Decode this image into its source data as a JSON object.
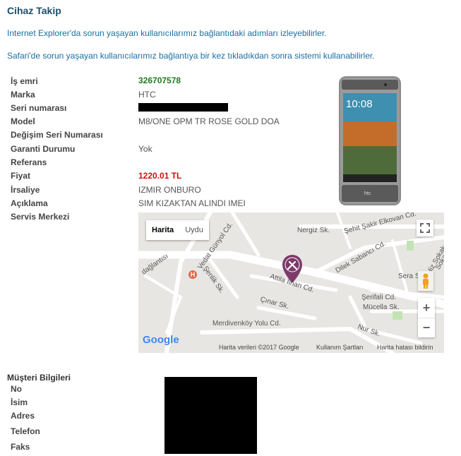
{
  "header": {
    "title": "Cihaz Takip"
  },
  "notes": {
    "ie": "Internet Explorer'da sorun yaşayan kullanıcılarımız bağlantıdaki adımları izleyebilirler.",
    "safari": "Safari'de sorun yaşayan kullanıcılarımız bağlantıya bir kez tıkladıkdan sonra sistemi kullanabilirler."
  },
  "details": {
    "is_emri": {
      "label": "İş emri",
      "value": "326707578"
    },
    "marka": {
      "label": "Marka",
      "value": "HTC"
    },
    "seri_no": {
      "label": "Seri numarası",
      "value": ""
    },
    "model": {
      "label": "Model",
      "value": "M8/ONE OPM TR ROSE GOLD DOA"
    },
    "degisim": {
      "label": "Değişim Seri Numarası",
      "value": ""
    },
    "garanti": {
      "label": "Garanti Durumu",
      "value": "Yok"
    },
    "referans": {
      "label": "Referans",
      "value": ""
    },
    "fiyat": {
      "label": "Fiyat",
      "value": "1220.01 TL"
    },
    "irsaliye": {
      "label": "İrsaliye",
      "value": "IZMIR ONBURO"
    },
    "aciklama": {
      "label": "Açıklama",
      "value": "SIM KIZAKTAN ALINDI IMEI"
    },
    "servis": {
      "label": "Servis Merkezi",
      "value": ""
    }
  },
  "phone": {
    "time": "10:08",
    "brand": "htc"
  },
  "map": {
    "type_map": "Harita",
    "type_sat": "Uydu",
    "streets": [
      "Nergiz Sk.",
      "Şehit Şakir Elkovan Cd.",
      "Vedat Günyol Cd.",
      "Dilek Sabancı Cd.",
      "Hiz Sokak",
      "Şenlik Sk.",
      "Attila İlhan Cd.",
      "Sera Sk.",
      "Şerifali Cd.",
      "Çınar Sk.",
      "Mücella Sk.",
      "Merdivenköy Yolu Cd.",
      "Nur Sk.",
      "Soka",
      "dağlantısı"
    ],
    "footer_data": "Harita verileri ©2017 Google",
    "footer_terms": "Kullanım Şartları",
    "footer_report": "Harita hatası bildirin",
    "google": "Google",
    "hospital": "H",
    "zoom_in": "+",
    "zoom_out": "−"
  },
  "customer": {
    "title": "Müşteri Bilgileri",
    "fields": [
      "No",
      "İsim",
      "Adres",
      "Telefon",
      "Faks"
    ]
  },
  "colors": {
    "title": "#1c4f6a",
    "note": "#1a6fa0",
    "green": "#1f7a1f",
    "red": "#cc1111",
    "pin": "#7d3a6b"
  }
}
